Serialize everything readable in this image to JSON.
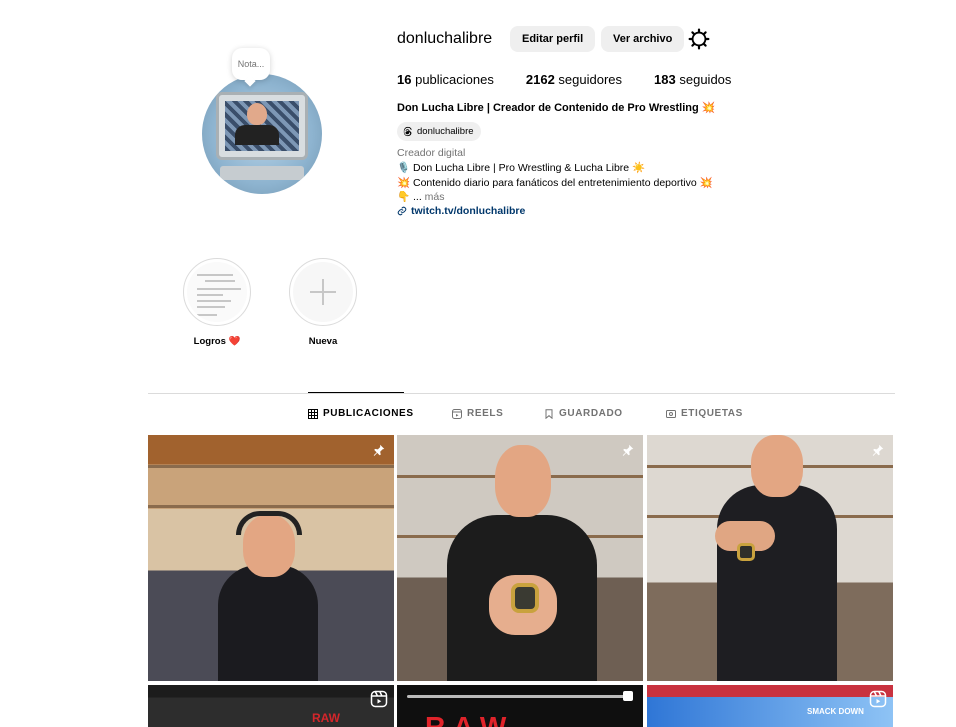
{
  "profile": {
    "username": "donluchalibre",
    "note_placeholder": "Nota...",
    "buttons": {
      "edit": "Editar perfil",
      "archive": "Ver archivo"
    },
    "stats": [
      {
        "count": "16",
        "label": "publicaciones"
      },
      {
        "count": "2162",
        "label": "seguidores"
      },
      {
        "count": "183",
        "label": "seguidos"
      }
    ],
    "full_name": "Don Lucha Libre | Creador de Contenido de Pro Wrestling 💥",
    "threads_handle": "donluchalibre",
    "category": "Creador digital",
    "bio_lines": [
      "🎙️ Don Lucha Libre | Pro Wrestling & Lucha Libre ☀️",
      "💥 Contenido diario para fanáticos del entretenimiento deportivo 💥",
      "👇 ..."
    ],
    "bio_more": "más",
    "link": "twitch.tv/donluchalibre"
  },
  "highlights": [
    {
      "label": "Logros ❤️"
    },
    {
      "label": "Nueva"
    }
  ],
  "tabs": [
    {
      "label": "PUBLICACIONES",
      "icon": "grid-icon",
      "active": true
    },
    {
      "label": "REELS",
      "icon": "reels-icon",
      "active": false
    },
    {
      "label": "GUARDADO",
      "icon": "bookmark-icon",
      "active": false
    },
    {
      "label": "ETIQUETAS",
      "icon": "tag-icon",
      "active": false
    }
  ],
  "posts": [
    {
      "type": "photo",
      "pinned": true
    },
    {
      "type": "photo",
      "pinned": true
    },
    {
      "type": "photo",
      "pinned": true
    },
    {
      "type": "reel",
      "text": "RAW"
    },
    {
      "type": "reel",
      "text": "RAW"
    },
    {
      "type": "reel",
      "text": "SMACK DOWN"
    }
  ],
  "colors": {
    "button_bg": "#efefef",
    "link": "#00376b",
    "muted": "#737373",
    "divider": "#dbdbdb"
  }
}
